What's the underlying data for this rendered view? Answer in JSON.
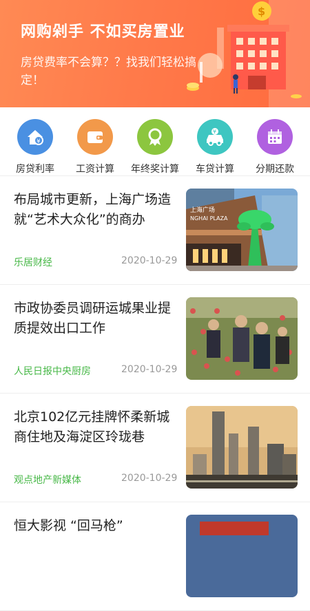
{
  "banner": {
    "headline": "网购剁手  不如买房置业",
    "subline": "房贷费率不会算？？找我们轻松搞定！"
  },
  "tools": [
    {
      "label": "房贷利率",
      "icon": "house-coin-icon",
      "color": "#4a90e2"
    },
    {
      "label": "工资计算",
      "icon": "wallet-icon",
      "color": "#f2994a"
    },
    {
      "label": "年终奖计算",
      "icon": "award-ribbon-icon",
      "color": "#8cc63f"
    },
    {
      "label": "车贷计算",
      "icon": "car-coin-icon",
      "color": "#3ec6c1"
    },
    {
      "label": "分期还款",
      "icon": "calendar-icon",
      "color": "#b061e0"
    }
  ],
  "news": [
    {
      "title": "布局城市更新，上海广场造就“艺术大众化”的商办",
      "source": "乐居财经",
      "date": "2020-10-29"
    },
    {
      "title": "市政协委员调研运城果业提质提效出口工作",
      "source": "人民日报中央厨房",
      "date": "2020-10-29"
    },
    {
      "title": "北京102亿元挂牌怀柔新城商住地及海淀区玲珑巷",
      "source": "观点地产新媒体",
      "date": "2020-10-29"
    },
    {
      "title": "恒大影视 “回马枪”",
      "source": "",
      "date": ""
    }
  ],
  "images": {
    "plaza_sign": "上海广场",
    "plaza_sign_en": "NGHAI PLAZA"
  }
}
